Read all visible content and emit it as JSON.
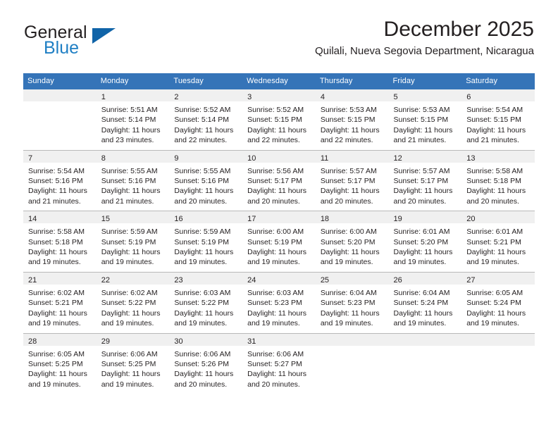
{
  "brand": {
    "name_part1": "General",
    "name_part2": "Blue",
    "triangle_color": "#1064a8",
    "blue_text_color": "#1f7fc4"
  },
  "header": {
    "title": "December 2025",
    "subtitle": "Quilali, Nueva Segovia Department, Nicaragua"
  },
  "theme": {
    "header_row_bg": "#3574b8",
    "header_row_text": "#ffffff",
    "daynum_band_bg": "#f0f0f0",
    "week_divider": "#2e6da4",
    "body_text": "#231f20"
  },
  "calendar": {
    "weekdays": [
      "Sunday",
      "Monday",
      "Tuesday",
      "Wednesday",
      "Thursday",
      "Friday",
      "Saturday"
    ],
    "weeks": [
      [
        {
          "day": "",
          "lines": []
        },
        {
          "day": "1",
          "lines": [
            "Sunrise: 5:51 AM",
            "Sunset: 5:14 PM",
            "Daylight: 11 hours",
            "and 23 minutes."
          ]
        },
        {
          "day": "2",
          "lines": [
            "Sunrise: 5:52 AM",
            "Sunset: 5:14 PM",
            "Daylight: 11 hours",
            "and 22 minutes."
          ]
        },
        {
          "day": "3",
          "lines": [
            "Sunrise: 5:52 AM",
            "Sunset: 5:15 PM",
            "Daylight: 11 hours",
            "and 22 minutes."
          ]
        },
        {
          "day": "4",
          "lines": [
            "Sunrise: 5:53 AM",
            "Sunset: 5:15 PM",
            "Daylight: 11 hours",
            "and 22 minutes."
          ]
        },
        {
          "day": "5",
          "lines": [
            "Sunrise: 5:53 AM",
            "Sunset: 5:15 PM",
            "Daylight: 11 hours",
            "and 21 minutes."
          ]
        },
        {
          "day": "6",
          "lines": [
            "Sunrise: 5:54 AM",
            "Sunset: 5:15 PM",
            "Daylight: 11 hours",
            "and 21 minutes."
          ]
        }
      ],
      [
        {
          "day": "7",
          "lines": [
            "Sunrise: 5:54 AM",
            "Sunset: 5:16 PM",
            "Daylight: 11 hours",
            "and 21 minutes."
          ]
        },
        {
          "day": "8",
          "lines": [
            "Sunrise: 5:55 AM",
            "Sunset: 5:16 PM",
            "Daylight: 11 hours",
            "and 21 minutes."
          ]
        },
        {
          "day": "9",
          "lines": [
            "Sunrise: 5:55 AM",
            "Sunset: 5:16 PM",
            "Daylight: 11 hours",
            "and 20 minutes."
          ]
        },
        {
          "day": "10",
          "lines": [
            "Sunrise: 5:56 AM",
            "Sunset: 5:17 PM",
            "Daylight: 11 hours",
            "and 20 minutes."
          ]
        },
        {
          "day": "11",
          "lines": [
            "Sunrise: 5:57 AM",
            "Sunset: 5:17 PM",
            "Daylight: 11 hours",
            "and 20 minutes."
          ]
        },
        {
          "day": "12",
          "lines": [
            "Sunrise: 5:57 AM",
            "Sunset: 5:17 PM",
            "Daylight: 11 hours",
            "and 20 minutes."
          ]
        },
        {
          "day": "13",
          "lines": [
            "Sunrise: 5:58 AM",
            "Sunset: 5:18 PM",
            "Daylight: 11 hours",
            "and 20 minutes."
          ]
        }
      ],
      [
        {
          "day": "14",
          "lines": [
            "Sunrise: 5:58 AM",
            "Sunset: 5:18 PM",
            "Daylight: 11 hours",
            "and 19 minutes."
          ]
        },
        {
          "day": "15",
          "lines": [
            "Sunrise: 5:59 AM",
            "Sunset: 5:19 PM",
            "Daylight: 11 hours",
            "and 19 minutes."
          ]
        },
        {
          "day": "16",
          "lines": [
            "Sunrise: 5:59 AM",
            "Sunset: 5:19 PM",
            "Daylight: 11 hours",
            "and 19 minutes."
          ]
        },
        {
          "day": "17",
          "lines": [
            "Sunrise: 6:00 AM",
            "Sunset: 5:19 PM",
            "Daylight: 11 hours",
            "and 19 minutes."
          ]
        },
        {
          "day": "18",
          "lines": [
            "Sunrise: 6:00 AM",
            "Sunset: 5:20 PM",
            "Daylight: 11 hours",
            "and 19 minutes."
          ]
        },
        {
          "day": "19",
          "lines": [
            "Sunrise: 6:01 AM",
            "Sunset: 5:20 PM",
            "Daylight: 11 hours",
            "and 19 minutes."
          ]
        },
        {
          "day": "20",
          "lines": [
            "Sunrise: 6:01 AM",
            "Sunset: 5:21 PM",
            "Daylight: 11 hours",
            "and 19 minutes."
          ]
        }
      ],
      [
        {
          "day": "21",
          "lines": [
            "Sunrise: 6:02 AM",
            "Sunset: 5:21 PM",
            "Daylight: 11 hours",
            "and 19 minutes."
          ]
        },
        {
          "day": "22",
          "lines": [
            "Sunrise: 6:02 AM",
            "Sunset: 5:22 PM",
            "Daylight: 11 hours",
            "and 19 minutes."
          ]
        },
        {
          "day": "23",
          "lines": [
            "Sunrise: 6:03 AM",
            "Sunset: 5:22 PM",
            "Daylight: 11 hours",
            "and 19 minutes."
          ]
        },
        {
          "day": "24",
          "lines": [
            "Sunrise: 6:03 AM",
            "Sunset: 5:23 PM",
            "Daylight: 11 hours",
            "and 19 minutes."
          ]
        },
        {
          "day": "25",
          "lines": [
            "Sunrise: 6:04 AM",
            "Sunset: 5:23 PM",
            "Daylight: 11 hours",
            "and 19 minutes."
          ]
        },
        {
          "day": "26",
          "lines": [
            "Sunrise: 6:04 AM",
            "Sunset: 5:24 PM",
            "Daylight: 11 hours",
            "and 19 minutes."
          ]
        },
        {
          "day": "27",
          "lines": [
            "Sunrise: 6:05 AM",
            "Sunset: 5:24 PM",
            "Daylight: 11 hours",
            "and 19 minutes."
          ]
        }
      ],
      [
        {
          "day": "28",
          "lines": [
            "Sunrise: 6:05 AM",
            "Sunset: 5:25 PM",
            "Daylight: 11 hours",
            "and 19 minutes."
          ]
        },
        {
          "day": "29",
          "lines": [
            "Sunrise: 6:06 AM",
            "Sunset: 5:25 PM",
            "Daylight: 11 hours",
            "and 19 minutes."
          ]
        },
        {
          "day": "30",
          "lines": [
            "Sunrise: 6:06 AM",
            "Sunset: 5:26 PM",
            "Daylight: 11 hours",
            "and 20 minutes."
          ]
        },
        {
          "day": "31",
          "lines": [
            "Sunrise: 6:06 AM",
            "Sunset: 5:27 PM",
            "Daylight: 11 hours",
            "and 20 minutes."
          ]
        },
        {
          "day": "",
          "lines": []
        },
        {
          "day": "",
          "lines": []
        },
        {
          "day": "",
          "lines": []
        }
      ]
    ]
  }
}
